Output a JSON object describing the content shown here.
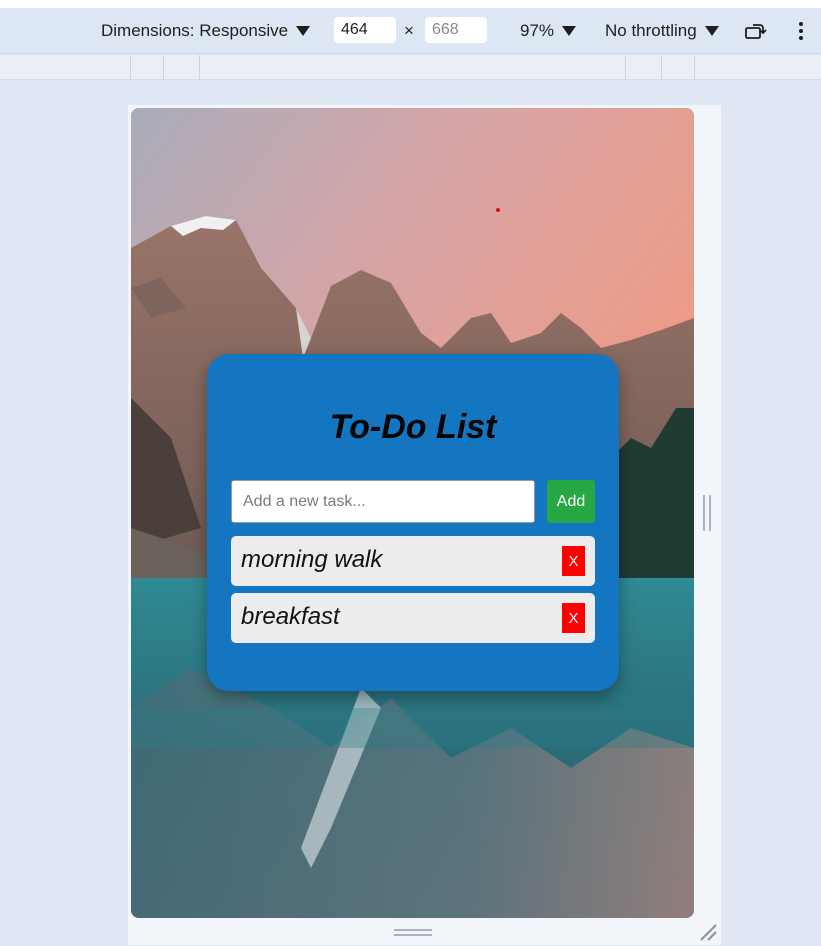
{
  "devtools": {
    "dimensions_label": "Dimensions: Responsive",
    "width_value": "464",
    "times_symbol": "×",
    "height_value": "668",
    "zoom": "97%",
    "throttling": "No throttling",
    "rotate_icon": "rotate-device-icon",
    "more_icon": "more-options-icon"
  },
  "app": {
    "title": "To-Do List",
    "input_placeholder": "Add a new task...",
    "input_value": "",
    "add_label": "Add",
    "tasks": [
      {
        "text": "morning walk",
        "delete_label": "X"
      },
      {
        "text": "breakfast",
        "delete_label": "X"
      }
    ]
  },
  "colors": {
    "card": "#1475c1",
    "add_button": "#28a745",
    "delete_button": "#ff0000",
    "task_background": "#ececec"
  }
}
